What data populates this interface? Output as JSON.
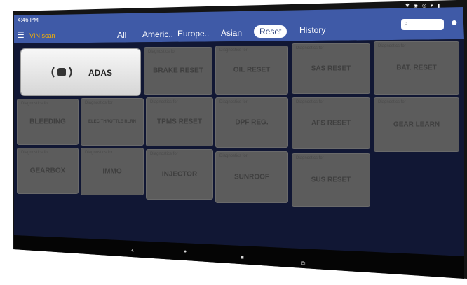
{
  "status": {
    "time": "4:46 PM",
    "icons": "✱ ◉ ◎ ▾ ▮"
  },
  "header": {
    "menu_icon": "menu-icon",
    "vin_label": "VIN scan",
    "tabs": [
      {
        "label": "All"
      },
      {
        "label": "Americ.."
      },
      {
        "label": "Europe.."
      },
      {
        "label": "Asian"
      },
      {
        "label": "Reset"
      },
      {
        "label": "History"
      }
    ],
    "active_tab": "Reset",
    "search_icon": "search-icon",
    "user_icon": "user-icon"
  },
  "tiles": [
    {
      "caption": "",
      "label": "ADAS",
      "icon": "adas-car-icon"
    },
    {
      "caption": "Diagnostics for",
      "label": "BRAKE RESET"
    },
    {
      "caption": "Diagnostics for",
      "label": "OIL RESET"
    },
    {
      "caption": "Diagnostics for",
      "label": "SAS RESET"
    },
    {
      "caption": "Diagnostics for",
      "label": "BAT. RESET"
    },
    {
      "caption": "Diagnostics for",
      "label": "BLEEDING"
    },
    {
      "caption": "Diagnostics for",
      "label": "ELEC THROTTLE RLRN"
    },
    {
      "caption": "Diagnostics for",
      "label": "TPMS RESET"
    },
    {
      "caption": "Diagnostics for",
      "label": "DPF REG."
    },
    {
      "caption": "Diagnostics for",
      "label": "AFS RESET"
    },
    {
      "caption": "Diagnostics for",
      "label": "GEAR LEARN"
    },
    {
      "caption": "Diagnostics for",
      "label": "GEARBOX"
    },
    {
      "caption": "Diagnostics for",
      "label": "IMMO"
    },
    {
      "caption": "Diagnostics for",
      "label": "INJECTOR"
    },
    {
      "caption": "Diagnostics for",
      "label": "SUNROOF"
    },
    {
      "caption": "Diagnostics for",
      "label": "SUS RESET"
    }
  ],
  "nav": {
    "back": "‹",
    "home": "●",
    "recent": "■",
    "screenshot": "⧉"
  },
  "colors": {
    "header_bg": "#3f5aa7",
    "body_bg": "#0f1535",
    "tile_bg": "#5c5c5c",
    "accent": "#f5b000"
  }
}
